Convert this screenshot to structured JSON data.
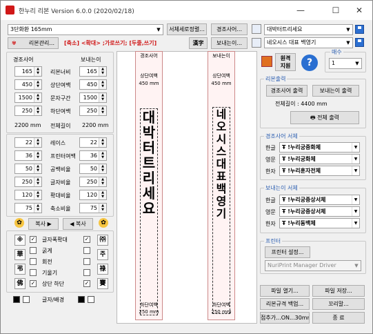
{
  "window": {
    "title": "한누리 리본 Version 6.0.0 (2020/02/18)",
    "minimize": "—",
    "maximize": "☐",
    "close": "✕"
  },
  "top": {
    "size_combo": "3단화환 165mm",
    "align_button": "서체세로정렬...",
    "greeting_button": "경조사어...",
    "greeting_value": "대박터트리세요",
    "ribbon_manage": "리본관리...",
    "shortcut_hint": "[축소] <확대> ;가로쓰기; [두줄,쓰기]",
    "hanja_button": "漢字",
    "sender_button": "보내는이...",
    "sender_value": "네오시스 대표 백영기"
  },
  "left_panel": {
    "col1_header": "경조사어",
    "col2_header": "보내는이",
    "rows": [
      {
        "label": "리본너비",
        "v1": "165",
        "v2": "165"
      },
      {
        "label": "상단여백",
        "v1": "450",
        "v2": "450"
      },
      {
        "label": "문자구간",
        "v1": "1500",
        "v2": "1500"
      },
      {
        "label": "하단여백",
        "v1": "250",
        "v2": "250"
      }
    ],
    "total_left": "2200 mm",
    "total_label": "전체길이",
    "total_right": "2200 mm",
    "rows2": [
      {
        "label": "레이스",
        "v1": "22",
        "v2": "22"
      },
      {
        "label": "프린터여백",
        "v1": "36",
        "v2": "36"
      },
      {
        "label": "공백비율",
        "v1": "50",
        "v2": "50"
      },
      {
        "label": "글자비율",
        "v1": "250",
        "v2": "250"
      },
      {
        "label": "확대비율",
        "v1": "120",
        "v2": "120"
      },
      {
        "label": "축소비율",
        "v1": "75",
        "v2": "75"
      }
    ],
    "copy_right": "복사",
    "copy_left": "복사",
    "checks": [
      {
        "label": "글자폭확대",
        "checked": true
      },
      {
        "label": "굵게",
        "checked": false
      },
      {
        "label": "회전",
        "checked": false
      },
      {
        "label": "기울기",
        "checked": false
      },
      {
        "label": "상단 하단",
        "checked": true
      }
    ],
    "symbols_left": [
      "※",
      "華",
      "弔",
      "佛"
    ],
    "symbols_right": [
      "㈜",
      "주",
      "祿",
      "賽"
    ],
    "color_label": "글자/배경"
  },
  "preview": {
    "left_label": "경조사어",
    "right_label": "보내는이",
    "top_margin_label": "상단여백",
    "top_margin_value": "450 mm",
    "bottom_margin_label": "하단여백",
    "bottom_margin_value": "250 mm",
    "left_text": "대박터트리세요",
    "right_text": "네오시스대표백영기"
  },
  "right_panel": {
    "original_label": "원격\n지원",
    "copies_label": "매수",
    "copies_value": "1",
    "ribbon_output_title": "리본출력",
    "greeting_print": "경조사어 출력",
    "sender_print": "보내는이 출력",
    "total_length": "전체길이 : 4400 mm",
    "print_all": "전체 출력",
    "greeting_font_title": "경조사어 서체",
    "sender_font_title": "보내는이 서체",
    "font_rows_greeting": [
      {
        "label": "한글",
        "font": "!누리궁중화체"
      },
      {
        "label": "영문",
        "font": "!누리궁화체"
      },
      {
        "label": "한자",
        "font": "!누리훈자전체"
      }
    ],
    "font_rows_sender": [
      {
        "label": "한글",
        "font": "!누리궁중상서체"
      },
      {
        "label": "영문",
        "font": "!누리궁중상서체"
      },
      {
        "label": "한자",
        "font": "!누리동백체"
      }
    ],
    "printer_title": "프린터",
    "printer_settings": "프린터 설정...",
    "printer_driver": "NuriPrint Manager Driver",
    "file_open": "파일 열기...",
    "file_save": "파일 저장...",
    "ribbon_backup": "리본규격 백업...",
    "tail": "꼬리말...",
    "bottom_hint": "점추가...ON...30mm",
    "exit": "종 료"
  },
  "colors": {
    "ribbon_fill": "#fff3f3",
    "accent_blue": "#2a5db0",
    "red_text": "#d01818"
  }
}
